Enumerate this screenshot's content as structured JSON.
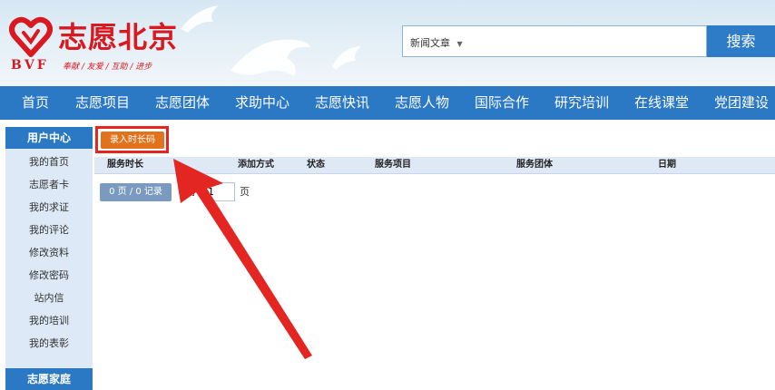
{
  "header": {
    "logo_title": "志愿北京",
    "logo_abbr": "BVF",
    "logo_slogan": "奉献 / 友爱 / 互助 / 进步",
    "search": {
      "category": "新闻文章",
      "button_label": "搜索"
    }
  },
  "nav": {
    "items": [
      "首页",
      "志愿项目",
      "志愿团体",
      "求助中心",
      "志愿快讯",
      "志愿人物",
      "国际合作",
      "研究培训",
      "在线课堂",
      "党团建设"
    ]
  },
  "sidebar": {
    "section_title": "用户中心",
    "items": [
      "我的首页",
      "志愿者卡",
      "我的求证",
      "我的评论",
      "修改资料",
      "修改密码",
      "站内信",
      "我的培训",
      "我的表彰"
    ],
    "next_section_title": "志愿家庭"
  },
  "main": {
    "record_button": "录入时长码",
    "table_headers": [
      "服务时长",
      "添加方式",
      "状态",
      "服务项目",
      "服务团体",
      "日期"
    ],
    "pager": {
      "info": "0 页 / 0 记录",
      "goto": "到",
      "page_value": "1",
      "unit": "页"
    }
  },
  "colors": {
    "brand_red": "#d9181f",
    "nav_blue": "#2b78c5",
    "accent_orange": "#e2731d",
    "annotation_red": "#e32622"
  }
}
